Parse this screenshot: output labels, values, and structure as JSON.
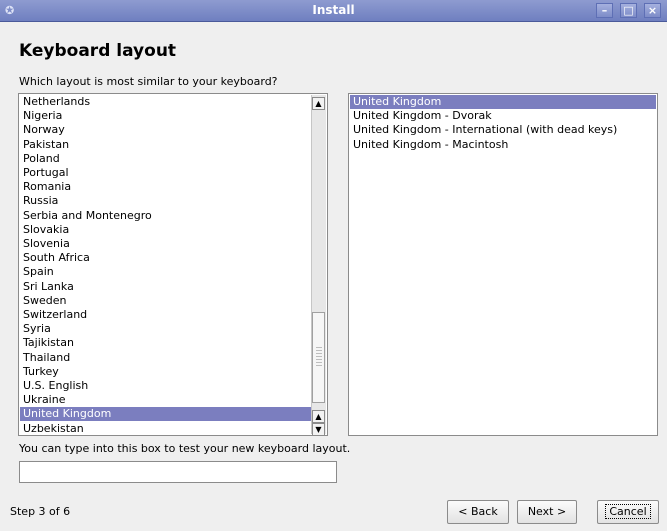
{
  "window": {
    "title": "Install"
  },
  "heading": "Keyboard layout",
  "question": "Which layout is most similar to your keyboard?",
  "countries": [
    "Netherlands",
    "Nigeria",
    "Norway",
    "Pakistan",
    "Poland",
    "Portugal",
    "Romania",
    "Russia",
    "Serbia and Montenegro",
    "Slovakia",
    "Slovenia",
    "South Africa",
    "Spain",
    "Sri Lanka",
    "Sweden",
    "Switzerland",
    "Syria",
    "Tajikistan",
    "Thailand",
    "Turkey",
    "U.S. English",
    "Ukraine",
    "United Kingdom",
    "Uzbekistan"
  ],
  "selected_country": "United Kingdom",
  "variants": [
    "United Kingdom",
    "United Kingdom - Dvorak",
    "United Kingdom - International (with dead keys)",
    "United Kingdom - Macintosh"
  ],
  "selected_variant": "United Kingdom",
  "test_hint": "You can type into this box to test your new keyboard layout.",
  "test_value": "",
  "step": "Step 3 of 6",
  "buttons": {
    "back": "< Back",
    "next": "Next >",
    "cancel": "Cancel"
  },
  "icons": {
    "app": "install-icon",
    "minimize": "minimize-icon",
    "maximize": "maximize-icon",
    "close": "close-icon",
    "up": "arrow-up-icon",
    "down": "arrow-down-icon"
  },
  "colors": {
    "titlebar": "#7d8cc8",
    "selection": "#7b7ebf"
  }
}
